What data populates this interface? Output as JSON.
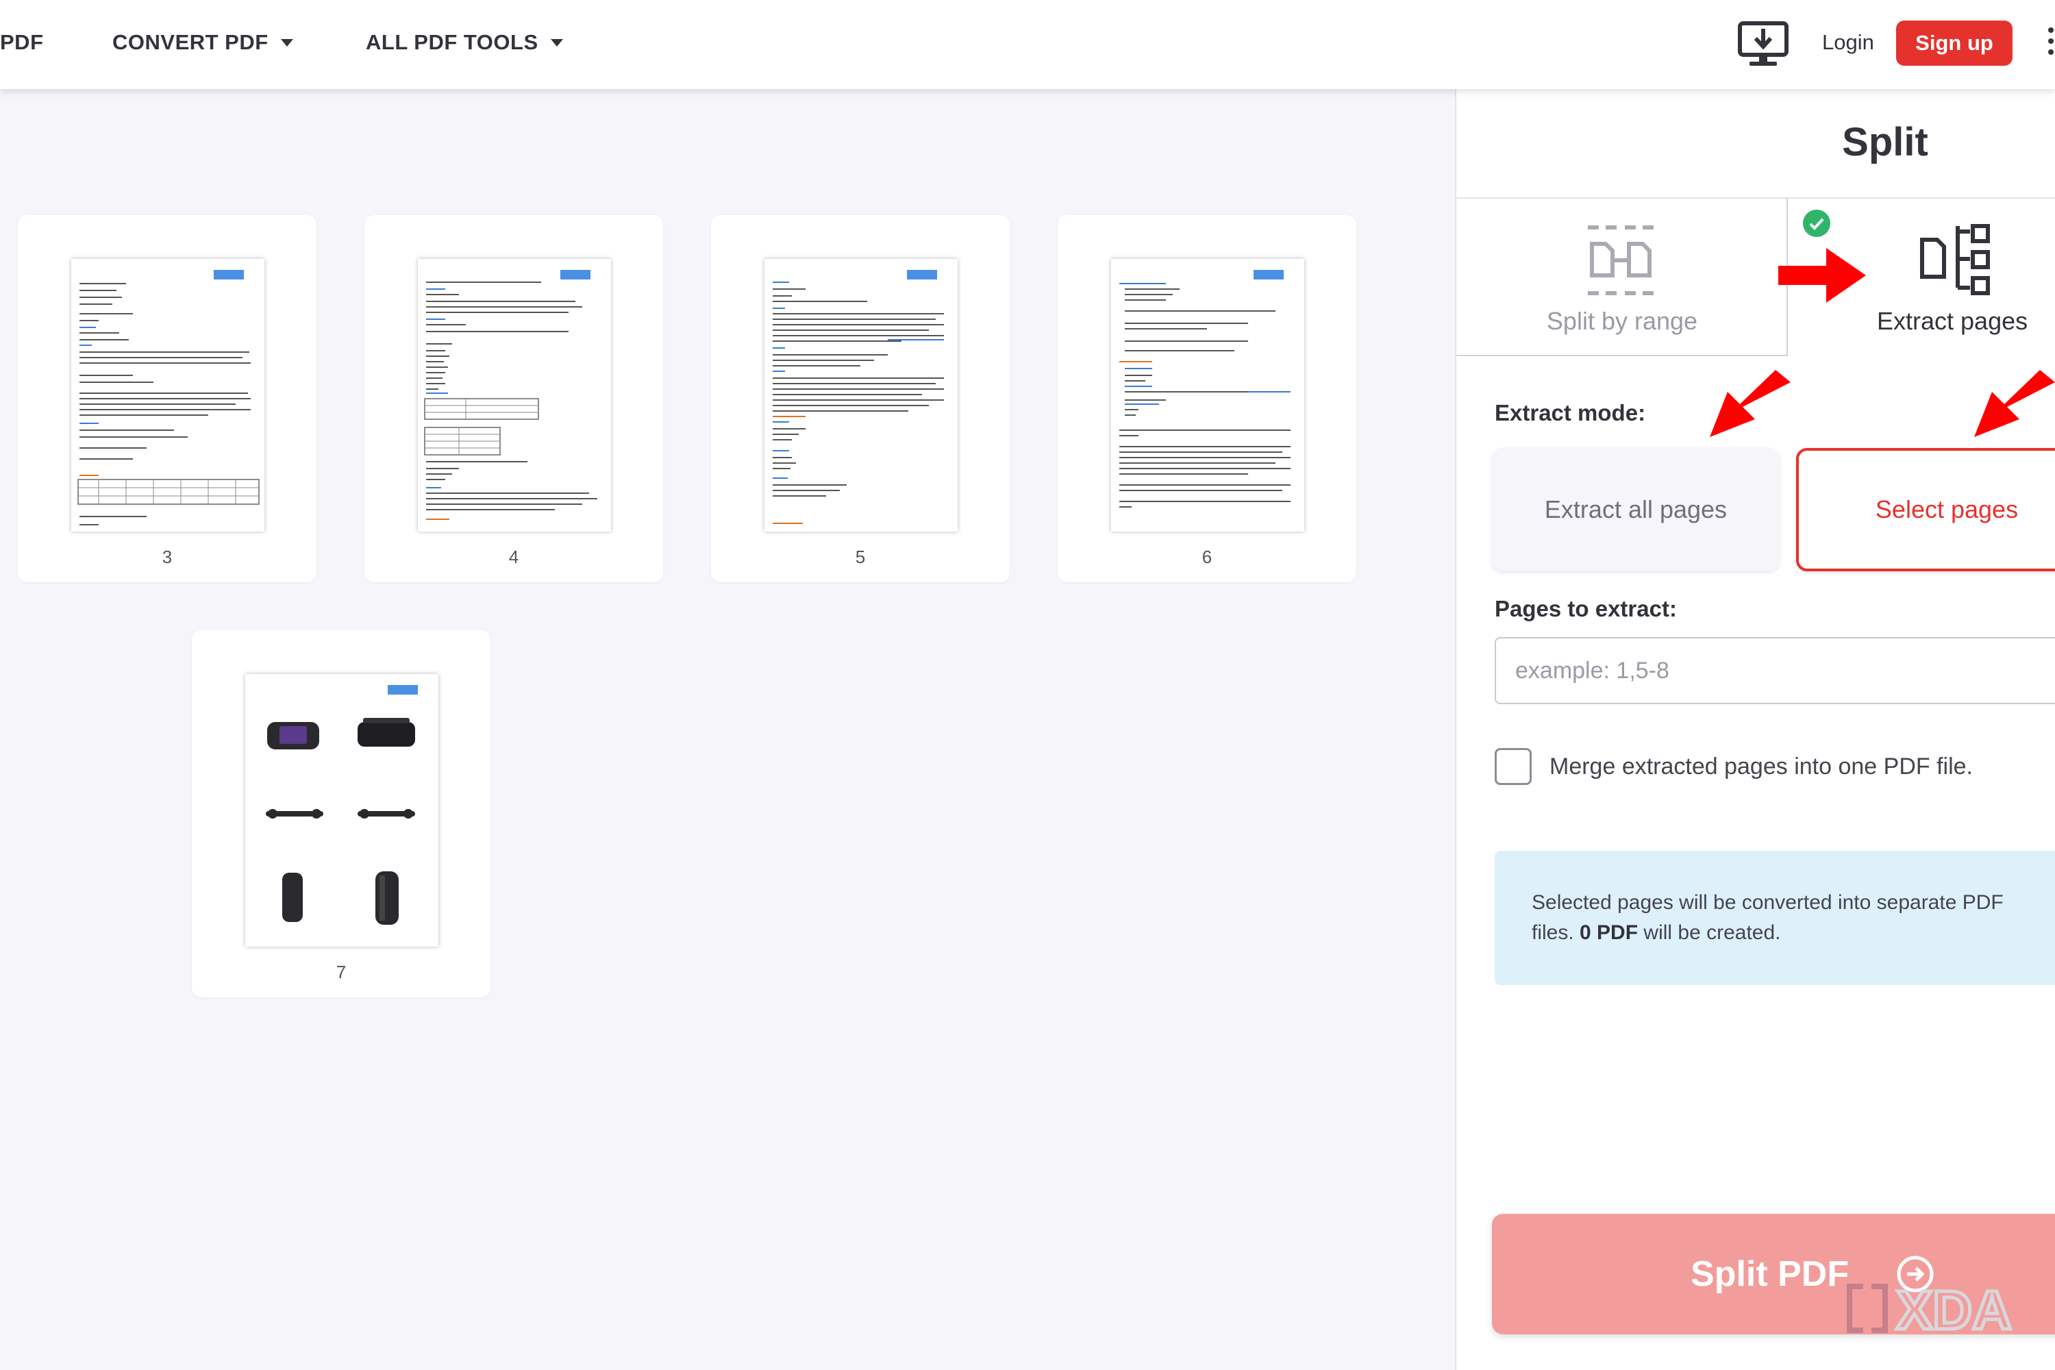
{
  "nav": {
    "brand_fragment": "PDF",
    "items": [
      {
        "label": "CONVERT PDF"
      },
      {
        "label": "ALL PDF TOOLS"
      }
    ],
    "login_label": "Login",
    "signup_label": "Sign up"
  },
  "thumbnails": [
    {
      "page": "3"
    },
    {
      "page": "4"
    },
    {
      "page": "5"
    },
    {
      "page": "6"
    },
    {
      "page": "7"
    }
  ],
  "panel": {
    "title": "Split",
    "tabs": [
      {
        "label": "Split by range",
        "active": false
      },
      {
        "label": "Extract pages",
        "active": true
      }
    ],
    "extract_mode_label": "Extract mode:",
    "modes": [
      {
        "label": "Extract all pages",
        "selected": false
      },
      {
        "label": "Select pages",
        "selected": true
      }
    ],
    "pages_to_extract_label": "Pages to extract:",
    "pages_input": {
      "placeholder": "example: 1,5-8",
      "value": ""
    },
    "merge_label": "Merge extracted pages into one PDF file.",
    "merge_checked": false,
    "info": {
      "text_before": "Selected pages will be converted into separate PDF files. ",
      "count_bold": "0 PDF",
      "text_after": " will be created."
    },
    "split_button_label": "Split PDF"
  },
  "watermark": {
    "label": "XDA"
  },
  "colors": {
    "brand_red": "#e5322d",
    "split_button": "#f29d9b",
    "info_bg": "#def1fb",
    "check_green": "#2fb569",
    "annotation_arrow": "#ff0000"
  }
}
